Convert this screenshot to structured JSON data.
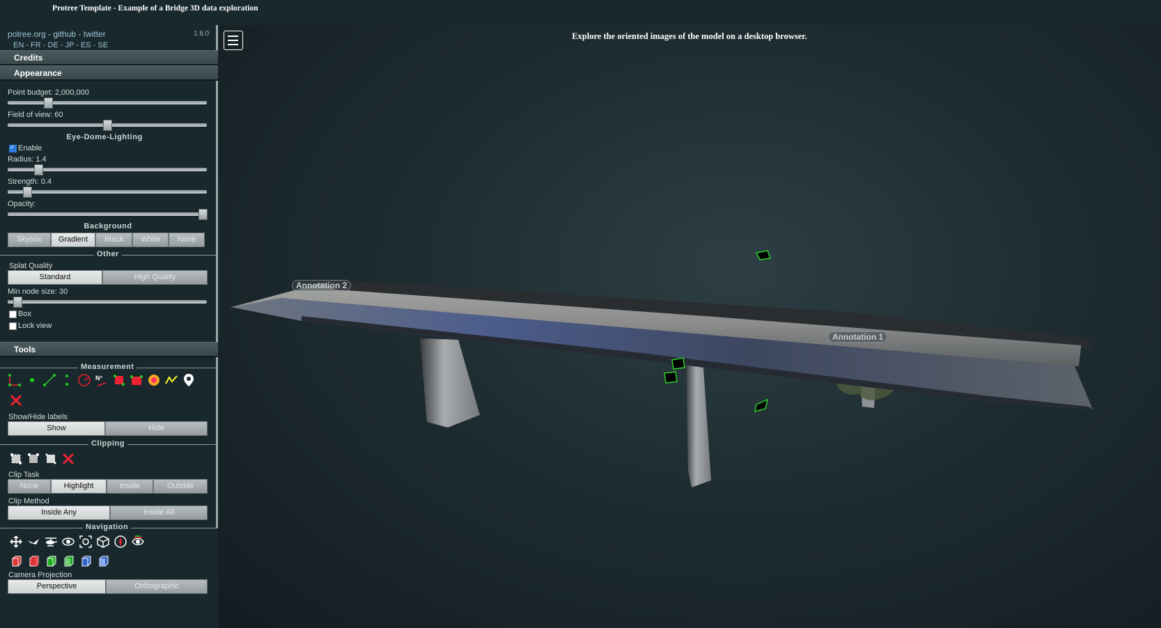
{
  "window": {
    "title": "Protree Template - Example of a Bridge 3D data exploration"
  },
  "sidebar": {
    "links": "potree.org - github - twitter",
    "version": "1.8.0",
    "languages": "EN - FR - DE - JP - ES - SE",
    "credits": "Credits",
    "appearance": {
      "title": "Appearance",
      "point_budget_label": "Point budget: 2,000,000",
      "fov_label": "Field of view: 60",
      "edl_title": "Eye-Dome-Lighting",
      "edl_enable": "Enable",
      "radius_label": "Radius: 1.4",
      "strength_label": "Strength: 0.4",
      "opacity_label": "Opacity:",
      "background_title": "Background",
      "background_options": [
        "Skybox",
        "Gradient",
        "Black",
        "White",
        "None"
      ],
      "background_selected": "Gradient",
      "other_title": "Other",
      "splat_quality_label": "Splat Quality",
      "splat_options": [
        "Standard",
        "High Quality"
      ],
      "min_node_label": "Min node size: 30",
      "box_label": "Box",
      "lock_view_label": "Lock view"
    },
    "tools": {
      "title": "Tools",
      "measurement_title": "Measurement",
      "labels_title": "Show/Hide labels",
      "labels_options": [
        "Show",
        "Hide"
      ],
      "clipping_title": "Clipping",
      "clip_task_label": "Clip Task",
      "clip_task_options": [
        "None",
        "Highlight",
        "Inside",
        "Outside"
      ],
      "clip_task_selected": "Highlight",
      "clip_method_label": "Clip Method",
      "clip_method_options": [
        "Inside Any",
        "Inside All"
      ],
      "navigation_title": "Navigation",
      "camera_projection_label": "Camera Projection",
      "camera_options": [
        "Perspective",
        "Orthographic"
      ]
    },
    "sliders": {
      "point_budget": 0.19,
      "fov": 0.5,
      "radius": 0.14,
      "strength": 0.08,
      "opacity": 1.0,
      "min_node_size": 0.03
    }
  },
  "viewer": {
    "message": "Explore the oriented images of the model on a desktop browser.",
    "annotations": [
      "Annotation 2",
      "Annotation 1"
    ]
  },
  "colors": {
    "panel_bg": "#19282c",
    "accent_link": "#9cc4d4",
    "image_frame_green": "#2bd12b"
  }
}
